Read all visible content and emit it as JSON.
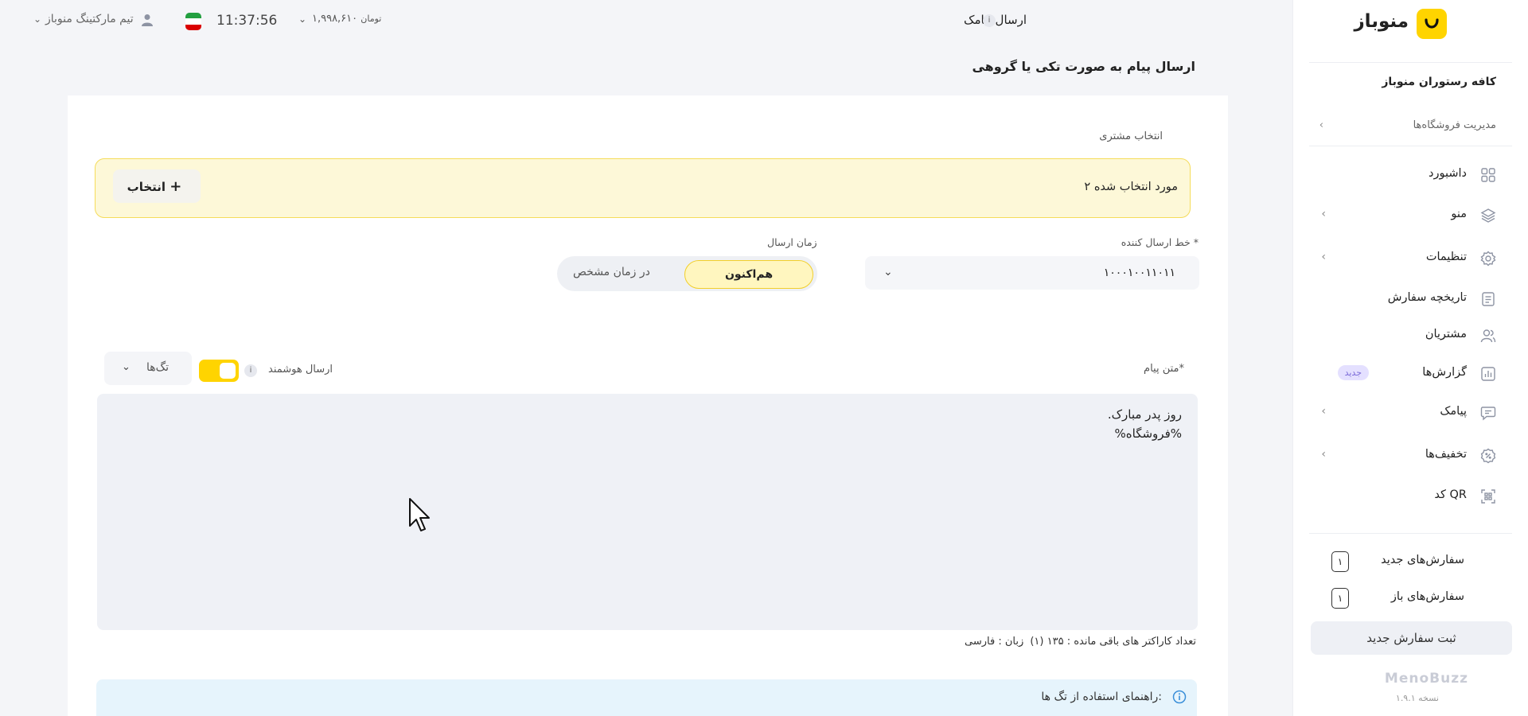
{
  "sidebar": {
    "logo_text": "منوباز",
    "store_name": "کافه رستوران منوباز",
    "store_manage": "مدیریت فروشگاه‌ها",
    "items": [
      {
        "label": "داشبورد",
        "icon": "grid-icon"
      },
      {
        "label": "منو",
        "icon": "layers-icon"
      },
      {
        "label": "تنظیمات",
        "icon": "gear-icon"
      },
      {
        "label": "تاریخچه سفارش",
        "icon": "document-icon"
      },
      {
        "label": "مشتریان",
        "icon": "users-icon"
      },
      {
        "label": "گزارش‌ها",
        "icon": "chart-icon",
        "badge": "جدید"
      },
      {
        "label": "پیامک",
        "icon": "message-icon"
      },
      {
        "label": "تخفیف‌ها",
        "icon": "discount-icon"
      },
      {
        "label": "کد QR",
        "icon": "qr-icon"
      }
    ],
    "new_orders_label": "سفارش‌های جدید",
    "new_orders_count": "۱",
    "open_orders_label": "سفارش‌های باز",
    "open_orders_count": "۱",
    "new_order_button": "ثبت سفارش جدید",
    "brand_footer": "MenoBuzz",
    "version": "نسخه ۱.۹.۱"
  },
  "topbar": {
    "page_title": "ارسال پیامک",
    "info_glyph": "i",
    "balance": "۱,۹۹۸,۶۱۰",
    "balance_unit": "تومان",
    "time": "11:37:56",
    "user_name": "تیم مارکتینگ منوباز"
  },
  "form": {
    "title": "ارسال پیام به صورت تکی یا گروهی",
    "customer_label": "انتخاب مشتری",
    "selected_count": "۲ مورد انتخاب شده",
    "select_button": "انتخاب",
    "sender_label": "خط ارسال کننده *",
    "sender_value": "۱۰۰۰۱۰۰۱۱۰۱۱",
    "send_time_label": "زمان ارسال",
    "send_now": "هم‌اکنون",
    "send_later": "در زمان مشخص",
    "message_label": "متن پیام*",
    "smart_send_label": "ارسال هوشمند",
    "tags_label": "تگ‌ها",
    "message_text": "روز پدر مبارک.\n%فروشگاه%",
    "counter_text": "تعداد کاراکتر های باقی مانده : ۱۳۵ (۱)",
    "language_text": "زبان : فارسی",
    "guide_text": "راهنمای استفاده از تگ ها:"
  },
  "colors": {
    "accent": "#ffd400",
    "badge_bg": "#e4e0ff",
    "badge_text": "#7a6ad8",
    "guide_bg": "#e6f4fc"
  }
}
